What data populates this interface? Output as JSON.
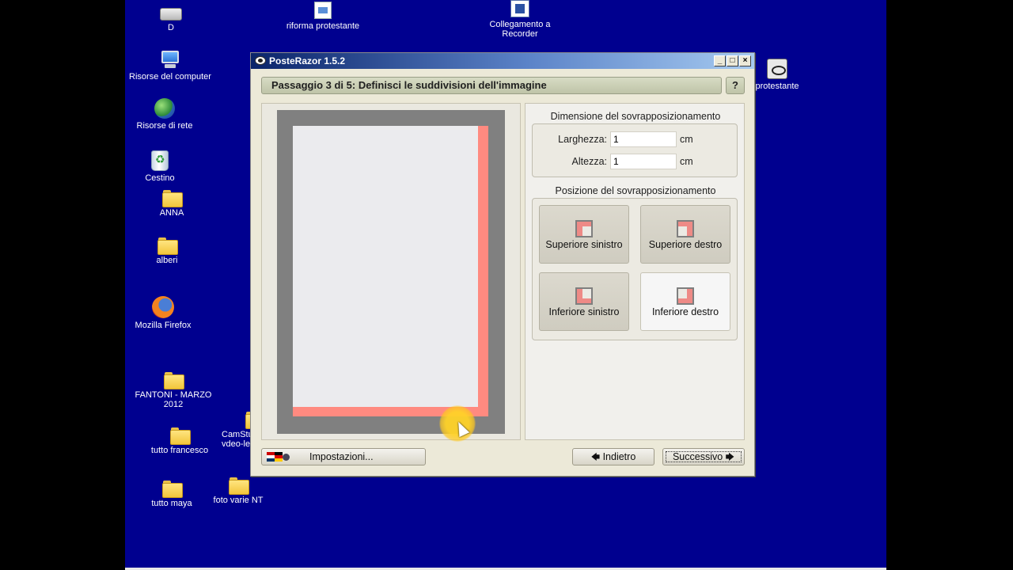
{
  "desktop_icons": [
    {
      "label": "D",
      "icon": "drive-icon"
    },
    {
      "label": "riforma protestante",
      "icon": "document-icon"
    },
    {
      "label": "Collegamento a Recorder",
      "icon": "shortcut-icon"
    },
    {
      "label": "Risorse del computer",
      "icon": "computer-icon"
    },
    {
      "label": "Risorse di rete",
      "icon": "network-icon"
    },
    {
      "label": "Cestino",
      "icon": "recycle-bin-icon"
    },
    {
      "label": "ANNA",
      "icon": "folder-icon"
    },
    {
      "label": "alberi",
      "icon": "folder-icon"
    },
    {
      "label": "Mozilla Firefox",
      "icon": "firefox-icon"
    },
    {
      "label": "FANTONI - MARZO 2012",
      "icon": "folder-icon"
    },
    {
      "label": "tutto francesco",
      "icon": "folder-icon"
    },
    {
      "label": "CamStudio vdeo-lez",
      "icon": "folder-icon"
    },
    {
      "label": "foto varie NT",
      "icon": "folder-icon"
    },
    {
      "label": "tutto maya",
      "icon": "folder-icon"
    },
    {
      "label": "protestante",
      "icon": "eye-icon"
    }
  ],
  "window": {
    "title": "PosteRazor 1.5.2",
    "step_title": "Passaggio 3 di 5: Definisci le suddivisioni dell'immagine",
    "help_label": "?",
    "overlap_size": {
      "group_title": "Dimensione del sovrapposizionamento",
      "width_label": "Larghezza:",
      "width_value": "1",
      "height_label": "Altezza:",
      "height_value": "1",
      "unit": "cm"
    },
    "overlap_position": {
      "group_title": "Posizione del sovrapposizionamento",
      "top_left": "Superiore sinistro",
      "top_right": "Superiore destro",
      "bottom_left": "Inferiore sinistro",
      "bottom_right": "Inferiore destro",
      "selected": "bottom_right"
    },
    "buttons": {
      "settings": "Impostazioni...",
      "back": "Indietro",
      "next": "Successivo"
    }
  },
  "colors": {
    "desktop": "#00008f",
    "overlap_highlight": "#ff8a80",
    "title_bar": "#0a246a"
  }
}
